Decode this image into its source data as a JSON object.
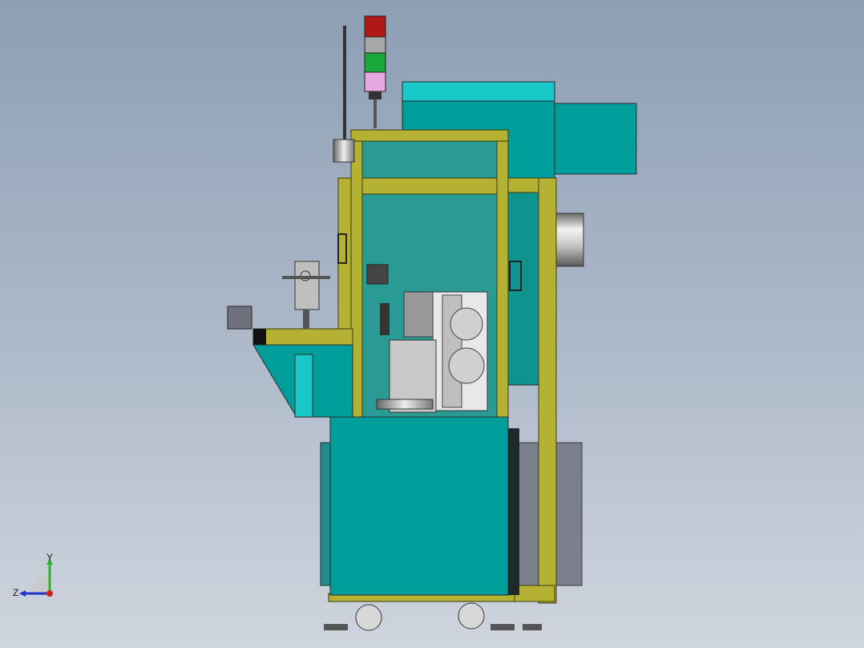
{
  "viewport": {
    "background_top": "#8d9fb4",
    "background_bottom": "#cfd5de"
  },
  "model": {
    "frame_color": "#b5b233",
    "panel_color": "#009e9a",
    "panel_light": "#18c8c8",
    "glass_color": "#2a9a94",
    "cabinet_gray": "#7b7e8c"
  },
  "signal_tower": {
    "lights": [
      "red",
      "gray",
      "green",
      "pink"
    ]
  },
  "triad": {
    "y_label": "Y",
    "z_label": "Z",
    "y_color": "#2bb22b",
    "z_color": "#2233cc",
    "x_color": "#d02020"
  }
}
